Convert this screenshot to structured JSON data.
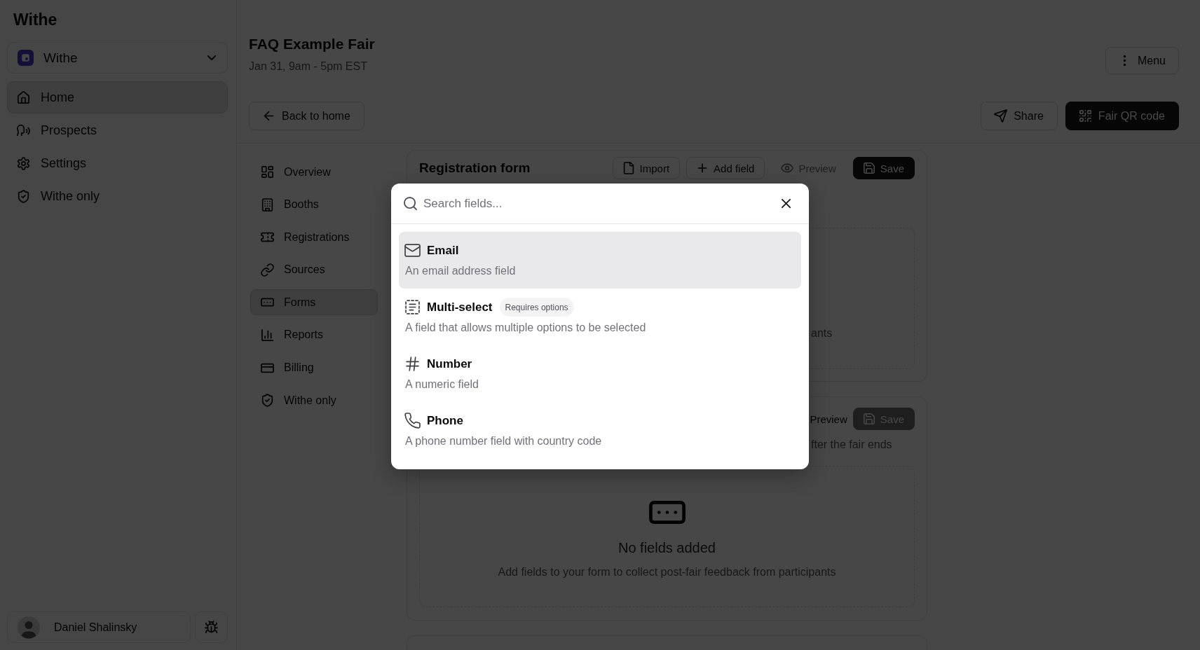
{
  "sidebar": {
    "title": "Withe",
    "org_switcher": {
      "label": "Withe"
    },
    "nav": [
      {
        "label": "Home",
        "selected": true
      },
      {
        "label": "Prospects",
        "selected": false
      },
      {
        "label": "Settings",
        "selected": false
      },
      {
        "label": "Withe only",
        "selected": false
      }
    ],
    "user": {
      "name": "Daniel Shalinsky"
    }
  },
  "header": {
    "title": "FAQ Example Fair",
    "subtitle": "Jan 31, 9am - 5pm EST",
    "menu_button": "Menu",
    "back_button": "Back to home",
    "share_button": "Share",
    "qr_button": "Fair QR code"
  },
  "subnav": [
    {
      "label": "Overview",
      "selected": false
    },
    {
      "label": "Booths",
      "selected": false
    },
    {
      "label": "Registrations",
      "selected": false
    },
    {
      "label": "Sources",
      "selected": false
    },
    {
      "label": "Forms",
      "selected": true
    },
    {
      "label": "Reports",
      "selected": false
    },
    {
      "label": "Billing",
      "selected": false
    },
    {
      "label": "Withe only",
      "selected": false
    }
  ],
  "cards": [
    {
      "title": "Registration form",
      "actions": [
        {
          "label": "Import",
          "kind": "outline",
          "disabled": false
        },
        {
          "label": "Add field",
          "kind": "outline",
          "disabled": false
        },
        {
          "label": "Preview",
          "kind": "ghost",
          "disabled": true
        },
        {
          "label": "Save",
          "kind": "primary",
          "disabled": false
        }
      ],
      "empty_state": {
        "description": "ants"
      }
    },
    {
      "actions": [
        {
          "label": "Preview",
          "kind": "text",
          "disabled": false
        },
        {
          "label": "Save",
          "kind": "primary",
          "disabled": true
        }
      ],
      "subtitle": "fter the fair ends",
      "empty_state": {
        "title": "No fields added",
        "description": "Add fields to your form to collect post-fair feedback from participants"
      }
    }
  ],
  "field_picker": {
    "search": {
      "placeholder": "Search fields..."
    },
    "options": [
      {
        "title": "Email",
        "description": "An email address field",
        "selected": true
      },
      {
        "title": "Multi-select",
        "badge": "Requires options",
        "description": "A field that allows multiple options to be selected",
        "selected": false
      },
      {
        "title": "Number",
        "description": "A numeric field",
        "selected": false
      },
      {
        "title": "Phone",
        "description": "A phone number field with country code",
        "selected": false
      }
    ]
  }
}
